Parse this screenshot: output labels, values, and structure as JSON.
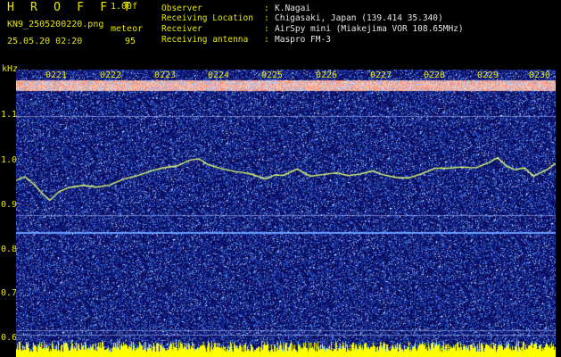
{
  "header": {
    "app_title": "H R O F F T",
    "version": "1.00f",
    "filename": "KN9_2505200220.png",
    "meteor_label": "meteor",
    "datetime": "25.05.20 02:20",
    "meteor_count": "95",
    "info": [
      {
        "label": "Observer",
        "value": "K.Nagai"
      },
      {
        "label": "Receiving Location",
        "value": "Chigasaki, Japan (139.414 35.340)"
      },
      {
        "label": "Receiver",
        "value": "AirSpy mini (Miakejima VOR 108.65MHz)"
      },
      {
        "label": "Receiving antenna",
        "value": "Maspro FM-3"
      }
    ]
  },
  "spectrogram": {
    "y_unit": "kHz",
    "time_ticks": [
      "0221",
      "0222",
      "0223",
      "0224",
      "0225",
      "0226",
      "0227",
      "0228",
      "0229",
      "0230"
    ],
    "freq_ticks": [
      "1.1",
      "1.0",
      "0.9",
      "0.8",
      "0.7",
      "0.6"
    ],
    "colors": {
      "background": "#0a0a5a",
      "noise": "#3a6cd8",
      "trace": "#e0ff70",
      "top_band": "#ff8060",
      "bottom_band": "#ffff00",
      "label": "#e8e800"
    }
  }
}
